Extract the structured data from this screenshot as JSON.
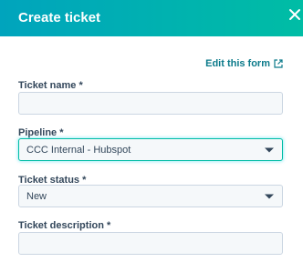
{
  "dialog": {
    "title": "Create ticket",
    "close_icon": "close-icon"
  },
  "form": {
    "edit_link": "Edit this form",
    "edit_icon": "external-link-icon",
    "fields": {
      "ticket_name": {
        "label": "Ticket name *",
        "value": ""
      },
      "pipeline": {
        "label": "Pipeline *",
        "value": "CCC Internal - Hubspot"
      },
      "ticket_status": {
        "label": "Ticket status *",
        "value": "New"
      },
      "ticket_description": {
        "label": "Ticket description *",
        "value": ""
      }
    }
  },
  "colors": {
    "header_gradient_start": "#00a4bd",
    "header_gradient_end": "#00bda5",
    "link": "#0b7a8a",
    "text": "#33475b",
    "field_bg": "#f5f8fa"
  }
}
